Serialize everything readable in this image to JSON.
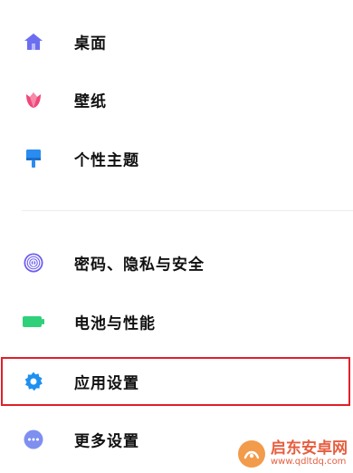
{
  "settings": {
    "items": [
      {
        "label": "桌面",
        "icon": "home-icon"
      },
      {
        "label": "壁纸",
        "icon": "tulip-icon"
      },
      {
        "label": "个性主题",
        "icon": "paintbrush-icon"
      },
      {
        "label": "密码、隐私与安全",
        "icon": "fingerprint-icon"
      },
      {
        "label": "电池与性能",
        "icon": "battery-icon"
      },
      {
        "label": "应用设置",
        "icon": "gear-icon"
      },
      {
        "label": "更多设置",
        "icon": "more-dots-icon"
      }
    ]
  },
  "watermark": {
    "title": "启东安卓网",
    "url": "www.qdltdq.com"
  },
  "colors": {
    "home": "#6b6ef0",
    "tulip": "#f0477a",
    "brush": "#2a8cf0",
    "fingerprint": "#6d5df0",
    "battery": "#2fd07a",
    "gear": "#1e90f0",
    "more": "#7f8ff0",
    "highlight": "#e0202a"
  }
}
